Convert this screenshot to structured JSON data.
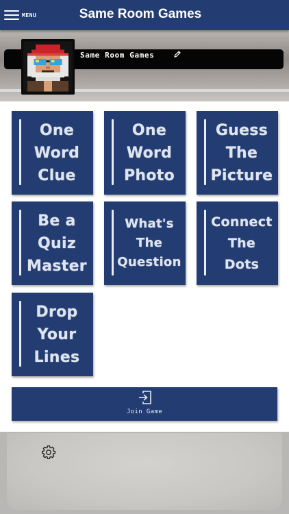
{
  "header": {
    "menu_label": "MENU",
    "title": "Same Room Games"
  },
  "profile": {
    "name": "Same Room Games",
    "avatar_icon": "pixel-art-avatar",
    "edit_icon": "pencil-icon"
  },
  "games": [
    {
      "lines": [
        "One",
        "Word",
        "Clue"
      ]
    },
    {
      "lines": [
        "One",
        "Word",
        "Photo"
      ]
    },
    {
      "lines": [
        "Guess",
        "The",
        "Picture"
      ]
    },
    {
      "lines": [
        "Be a",
        "Quiz",
        "Master"
      ]
    },
    {
      "lines": [
        "What's",
        "The",
        "Question"
      ]
    },
    {
      "lines": [
        "Connect",
        "The",
        "Dots"
      ]
    },
    {
      "lines": [
        "Drop",
        "Your",
        "Lines"
      ]
    }
  ],
  "join": {
    "label": "Join Game",
    "icon": "enter-icon"
  },
  "settings_icon": "gear-icon",
  "colors": {
    "brand": "#233c72",
    "tile_text": "#dfe5ee",
    "panel": "#ffffff"
  }
}
